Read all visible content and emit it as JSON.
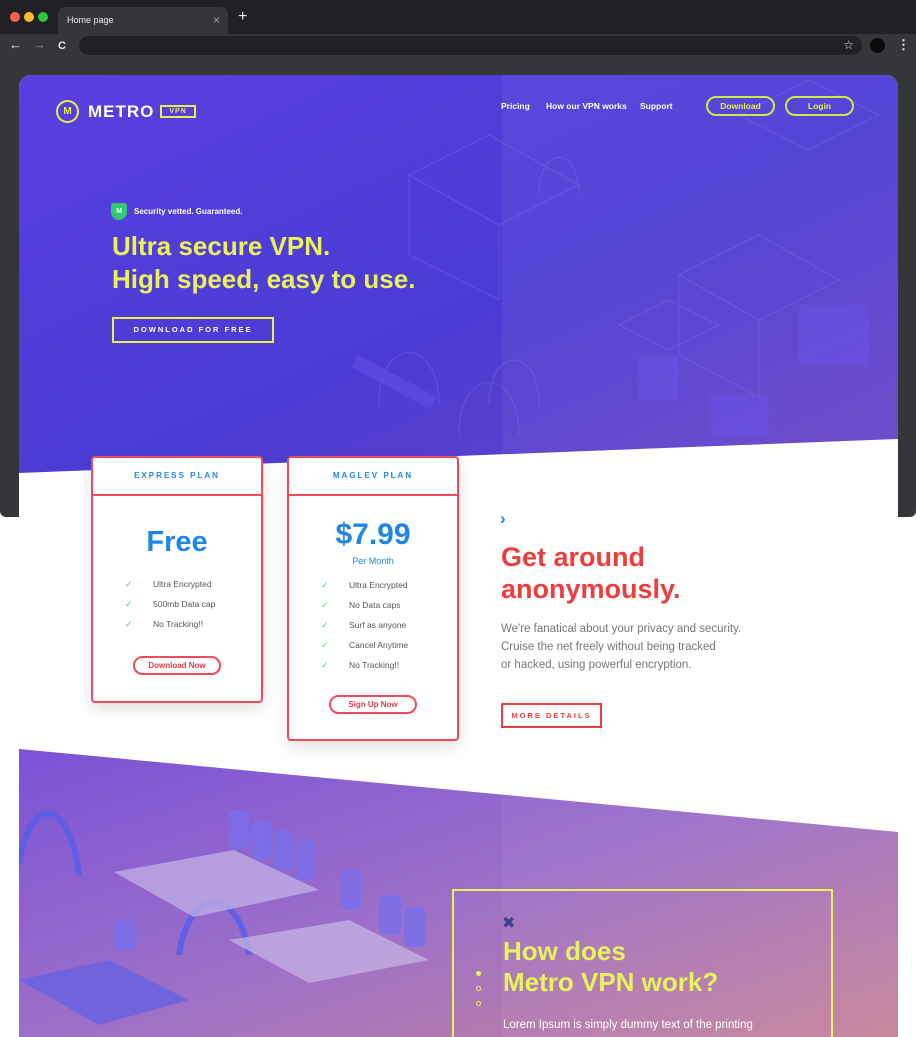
{
  "browser": {
    "tab_title": "Home page",
    "tab_close": "×",
    "new_tab": "+",
    "back": "←",
    "forward": "→",
    "reload": "C",
    "address": "",
    "star": "☆",
    "menu": "⋮",
    "traffic_colors": [
      "#ff5f57",
      "#febc2e",
      "#28c840"
    ]
  },
  "logo": {
    "mark": "M",
    "name": "METRO",
    "tag": "VPN"
  },
  "nav": {
    "links": [
      "Pricing",
      "How our VPN works",
      "Support"
    ],
    "download": "Download",
    "login": "Login"
  },
  "hero": {
    "badge_mark": "M",
    "badge": "Security vetted. Guaranteed.",
    "title_line1": "Ultra secure VPN.",
    "title_line2": "High speed, easy to use.",
    "cta": "DOWNLOAD FOR FREE"
  },
  "plans": [
    {
      "name": "EXPRESS PLAN",
      "price": "Free",
      "period": "",
      "features": [
        "Ultra Encrypted",
        "500mb Data cap",
        "No Tracking!!"
      ],
      "button": "Download Now"
    },
    {
      "name": "MAGLEV PLAN",
      "price": "$7.99",
      "period": "Per Month",
      "features": [
        "Ultra Encrypted",
        "No Data caps",
        "Surf as anyone",
        "Cancel Anytime",
        "No Tracking!!"
      ],
      "button": "Sign Up Now"
    }
  ],
  "anonymous": {
    "chevron": "›",
    "title_line1": "Get around",
    "title_line2": "anonymously.",
    "desc_line1": "We're fanatical about your privacy and security.",
    "desc_line2": "Cruise the net freely without being tracked",
    "desc_line3": "or hacked, using powerful encryption.",
    "button": "MORE DETAILS"
  },
  "how": {
    "icon": "✖",
    "title_line1": "How does",
    "title_line2": "Metro VPN work?",
    "text": "Lorem Ipsum is simply dummy text of the printing"
  },
  "colors": {
    "accent_yellow": "#eaf25a",
    "brand_blue": "#1f86e6",
    "brand_red": "#ec3e3e",
    "hero_purple": "#4f3fd6"
  },
  "icons": {
    "check": "✓"
  }
}
